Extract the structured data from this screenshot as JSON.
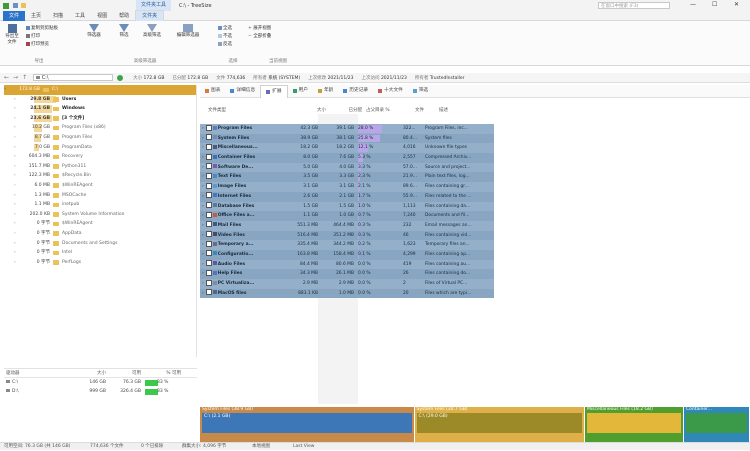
{
  "window": {
    "title_left": "C:\\ - TreeSize",
    "context_tab": "文件夹工具",
    "search_placeholder": "在窗口中搜索 (F3)",
    "minimize": "—",
    "maximize": "☐",
    "close": "✕"
  },
  "ribbon_tabs": [
    "文件",
    "主页",
    "扫描",
    "工具",
    "视图",
    "帮助",
    "文件夹"
  ],
  "ribbon": {
    "groups": [
      {
        "label": "导出",
        "buttons": [
          "导出至文件",
          "复制到剪贴板",
          "打印",
          "打印预览"
        ]
      },
      {
        "label": "高级筛选器",
        "buttons": [
          "筛选器",
          "筛选",
          "高级筛选",
          "编辑筛选器"
        ]
      },
      {
        "label": "选择",
        "buttons": [
          "全选",
          "不选",
          "反选"
        ]
      },
      {
        "label": "当前视图",
        "buttons": [
          "展开视图",
          "全部折叠"
        ]
      }
    ]
  },
  "address": {
    "path": "C:\\",
    "fields": [
      {
        "label": "大小",
        "value": "172.8 GB"
      },
      {
        "label": "已分配",
        "value": "172.8 GB"
      },
      {
        "label": "文件",
        "value": "774,636"
      },
      {
        "label": "所有者",
        "value": "系统 (SYSTEM)"
      },
      {
        "label": "上次修改",
        "value": "2021/11/23"
      },
      {
        "label": "上次访问",
        "value": "2021/11/23"
      },
      {
        "label": "所有者",
        "value": "TrustedInstaller"
      }
    ]
  },
  "tree": [
    {
      "size": "172.8 GB",
      "name": "C:\\",
      "pct": 100
    },
    {
      "size": "29.8 GB",
      "name": "Users",
      "pct": 17
    },
    {
      "size": "24.1 GB",
      "name": "Windows",
      "pct": 14
    },
    {
      "size": "23.6 GB",
      "name": "[3 个文件]",
      "pct": 14
    },
    {
      "size": "10.2 GB",
      "name": "Program Files (x86)",
      "pct": 6
    },
    {
      "size": "8.7 GB",
      "name": "Program Files",
      "pct": 5
    },
    {
      "size": "7.0 GB",
      "name": "ProgramData",
      "pct": 4
    },
    {
      "size": "604.3 MB",
      "name": "Recovery",
      "pct": 0.3
    },
    {
      "size": "151.7 MB",
      "name": "Python311",
      "pct": 0.1
    },
    {
      "size": "122.3 MB",
      "name": "$Recycle.Bin",
      "pct": 0.1
    },
    {
      "size": "6.0 MB",
      "name": "$WinREAgent",
      "pct": 0
    },
    {
      "size": "1.3 MB",
      "name": "MSOCache",
      "pct": 0
    },
    {
      "size": "1.1 MB",
      "name": "inetpub",
      "pct": 0
    },
    {
      "size": "202.0 KB",
      "name": "System Volume Information",
      "pct": 0
    },
    {
      "size": "0 字节",
      "name": "$WinREAgent",
      "pct": 0
    },
    {
      "size": "0 字节",
      "name": "AppData",
      "pct": 0
    },
    {
      "size": "0 字节",
      "name": "Documents and Settings",
      "pct": 0
    },
    {
      "size": "0 字节",
      "name": "Intel",
      "pct": 0
    },
    {
      "size": "0 字节",
      "name": "PerfLogs",
      "pct": 0
    }
  ],
  "drives": {
    "headers": [
      "驱动器",
      "大小",
      "可用",
      "% 可用"
    ],
    "rows": [
      {
        "name": "C:\\",
        "size": "146 GB",
        "free": "76.3 GB",
        "pct": "33 %",
        "fill": 0.33
      },
      {
        "name": "D:\\",
        "size": "999 GB",
        "free": "326.4 GB",
        "pct": "33 %",
        "fill": 0.33
      }
    ]
  },
  "right_tabs": [
    "图表",
    "详细信息",
    "扩展",
    "用户",
    "年龄",
    "历史记录",
    "十大文件",
    "筛选"
  ],
  "active_right_tab": 2,
  "filetype_columns": [
    "文件类型",
    "大小",
    "已分配",
    "占父目录 %",
    "文件",
    "描述"
  ],
  "filetypes": [
    {
      "name": "Program Files",
      "size": "42.3 GB",
      "alloc": "39.1 GB",
      "pct": "28.0 %",
      "files": "322...",
      "desc": "Program Files, inc...",
      "pct_val": 28
    },
    {
      "name": "System Files",
      "size": "38.9 GB",
      "alloc": "38.1 GB",
      "pct": "25.8 %",
      "files": "80.4...",
      "desc": "System files",
      "pct_val": 25.8
    },
    {
      "name": "Miscellaneous...",
      "size": "18.2 GB",
      "alloc": "18.2 GB",
      "pct": "12.1 %",
      "files": "4,016",
      "desc": "Unknown file types",
      "pct_val": 12.1
    },
    {
      "name": "Container Files",
      "size": "8.0 GB",
      "alloc": "7.6 GB",
      "pct": "5.3 %",
      "files": "2,557",
      "desc": "Compressed Archiv...",
      "pct_val": 5.3
    },
    {
      "name": "Software De...",
      "size": "5.0 GB",
      "alloc": "4.0 GB",
      "pct": "3.3 %",
      "files": "57.0...",
      "desc": "Source and project...",
      "pct_val": 3.3
    },
    {
      "name": "Text Files",
      "size": "3.5 GB",
      "alloc": "3.3 GB",
      "pct": "2.3 %",
      "files": "21.9...",
      "desc": "Plain text files, log...",
      "pct_val": 2.3
    },
    {
      "name": "Image Files",
      "size": "3.1 GB",
      "alloc": "3.1 GB",
      "pct": "2.1 %",
      "files": "89.6...",
      "desc": "Files containing gr...",
      "pct_val": 2.1
    },
    {
      "name": "Internet Files",
      "size": "2.6 GB",
      "alloc": "2.1 GB",
      "pct": "1.7 %",
      "files": "55.9...",
      "desc": "Files related to the ...",
      "pct_val": 1.7
    },
    {
      "name": "Database Files",
      "size": "1.5 GB",
      "alloc": "1.5 GB",
      "pct": "1.0 %",
      "files": "1,113",
      "desc": "Files containing da...",
      "pct_val": 1.0
    },
    {
      "name": "Office Files a...",
      "size": "1.1 GB",
      "alloc": "1.0 GB",
      "pct": "0.7 %",
      "files": "7,240",
      "desc": "Documents and fil...",
      "pct_val": 0.7
    },
    {
      "name": "Mail Files",
      "size": "551.3 MB",
      "alloc": "464.4 MB",
      "pct": "0.3 %",
      "files": "232",
      "desc": "Email messages an...",
      "pct_val": 0.3
    },
    {
      "name": "Video Files",
      "size": "516.4 MB",
      "alloc": "351.2 MB",
      "pct": "0.3 %",
      "files": "46",
      "desc": "Files containing vid...",
      "pct_val": 0.3
    },
    {
      "name": "Temporary a...",
      "size": "335.4 MB",
      "alloc": "344.2 MB",
      "pct": "0.2 %",
      "files": "1,623",
      "desc": "Temporary files an...",
      "pct_val": 0.2
    },
    {
      "name": "Configuratio...",
      "size": "163.8 MB",
      "alloc": "158.4 MB",
      "pct": "0.1 %",
      "files": "4,299",
      "desc": "Files containing ap...",
      "pct_val": 0.1
    },
    {
      "name": "Audio Files",
      "size": "84.4 MB",
      "alloc": "80.6 MB",
      "pct": "0.0 %",
      "files": "419",
      "desc": "Files containing au...",
      "pct_val": 0
    },
    {
      "name": "Help Files",
      "size": "34.3 MB",
      "alloc": "26.1 MB",
      "pct": "0.0 %",
      "files": "26",
      "desc": "Files containing do...",
      "pct_val": 0
    },
    {
      "name": "PC Virtualiza...",
      "size": "2.9 MB",
      "alloc": "2.9 MB",
      "pct": "0.0 %",
      "files": "2",
      "desc": "Files of Virtual PC...",
      "pct_val": 0
    },
    {
      "name": "MacOS files",
      "size": "883.1 KB",
      "alloc": "1.0 MB",
      "pct": "0.0 %",
      "files": "20",
      "desc": "Files which are typi...",
      "pct_val": 0
    }
  ],
  "treemap": {
    "blocks": [
      {
        "label": "System Files (38.9 GB)",
        "sub": "C:\\ (2.1 GB)",
        "color": "#c88a48",
        "inner": "#3e77b8",
        "share": 0.39
      },
      {
        "label": "System Files (30.7 GB)",
        "sub": "C:\\ (29.0 GB)",
        "color": "#dfb04a",
        "inner": "#9c8a28",
        "share": 0.31
      },
      {
        "label": "Miscellaneous Files (18.2 GB)",
        "sub": "",
        "color": "#4f9e2e",
        "inner": "#e3b83a",
        "share": 0.18
      },
      {
        "label": "Container...",
        "sub": "",
        "color": "#2f88b8",
        "inner": "#3b9a4a",
        "share": 0.12
      }
    ]
  },
  "statusbar": {
    "free": "可用空间: 76.3 GB (共 146 GB)",
    "files": "774,636 个文件",
    "excluded": "0 个已排除",
    "cluster": "群集大小: 4,096 字节",
    "view": "本地视图",
    "mode": "Last View"
  },
  "colors": {
    "accent": "#2b73c9",
    "selection": "#dba533",
    "table_row": "#93afc9",
    "pct_bar": "#b9a6e8"
  }
}
